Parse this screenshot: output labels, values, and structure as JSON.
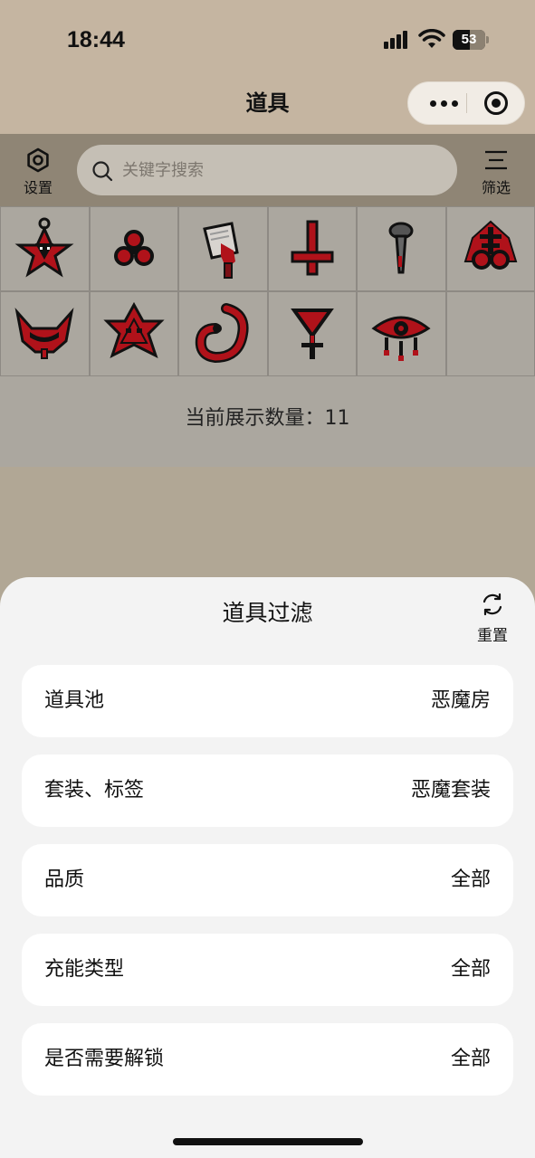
{
  "status": {
    "time": "18:44",
    "battery": "53",
    "battery_level": 0.53
  },
  "nav": {
    "title": "道具"
  },
  "toolbar": {
    "settings_label": "设置",
    "search_placeholder": "关键字搜索",
    "filter_label": "筛选"
  },
  "items": [
    {
      "icon": "goat-pentagram-icon"
    },
    {
      "icon": "triquetra-icon"
    },
    {
      "icon": "bloody-cleaver-icon"
    },
    {
      "icon": "inverted-cross-icon"
    },
    {
      "icon": "nail-icon"
    },
    {
      "icon": "leviathan-cross-icon"
    },
    {
      "icon": "horned-mask-icon"
    },
    {
      "icon": "demon-face-pentagram-icon"
    },
    {
      "icon": "blood-bag-icon"
    },
    {
      "icon": "alchemy-symbol-icon"
    },
    {
      "icon": "dripping-eye-icon"
    }
  ],
  "count": {
    "text": "当前展示数量：11"
  },
  "sheet": {
    "title": "道具过滤",
    "reset_label": "重置",
    "filters": [
      {
        "label": "道具池",
        "value": "恶魔房"
      },
      {
        "label": "套装、标签",
        "value": "恶魔套装"
      },
      {
        "label": "品质",
        "value": "全部"
      },
      {
        "label": "充能类型",
        "value": "全部"
      },
      {
        "label": "是否需要解锁",
        "value": "全部"
      }
    ]
  },
  "colors": {
    "status_bg": "#c5b5a1",
    "toolbar_bg": "#8f8575",
    "grid_cell_bg": "#aba79f",
    "sheet_bg": "#f3f3f3",
    "item_red": "#b0121a"
  }
}
